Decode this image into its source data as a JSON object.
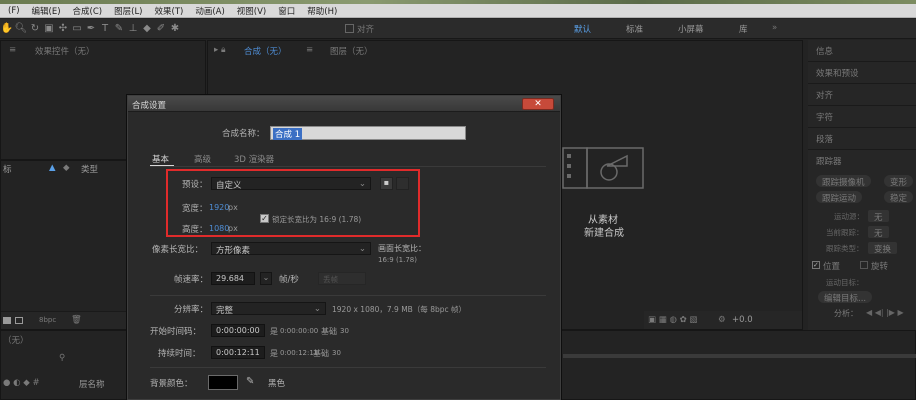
{
  "menu": [
    "(F)",
    "编辑(E)",
    "合成(C)",
    "图层(L)",
    "效果(T)",
    "动画(A)",
    "视图(V)",
    "窗口",
    "帮助(H)"
  ],
  "toolbar": {
    "align_label": "对齐",
    "workspaces": {
      "default": "默认",
      "standard": "标准",
      "small_screen": "小屏幕",
      "library": "库"
    }
  },
  "panels": {
    "effects_tab": "效果控件（无）",
    "comp_tab": "合成（无）",
    "layer_tab": "图层（无）",
    "project_sort_label": "标",
    "project_type_label": "类型",
    "bpc": "8bpc",
    "timeline_none": "（无）",
    "layer_name_label": "层名称",
    "empty_new_comp_line1": "从素材",
    "empty_new_comp_line2": "新建合成",
    "zoom_value": "+0.0"
  },
  "right_panel": {
    "items": [
      "信息",
      "效果和预设",
      "对齐",
      "字符",
      "段落",
      "跟踪器"
    ],
    "tracker": {
      "track_camera": "跟踪摄像机",
      "warp_stabilizer": "变形",
      "track_motion": "跟踪运动",
      "stabilize_motion": "稳定",
      "motion_source_label": "运动源：",
      "current_track_label": "当前跟踪：",
      "track_type_label": "跟踪类型：",
      "motion_source_value": "无",
      "current_track_value": "无",
      "track_type_value": "变换",
      "position_label": "位置",
      "rotation_label": "旋转",
      "motion_target_label": "运动目标：",
      "edit_target_button": "编辑目标...",
      "analyze_label": "分析："
    }
  },
  "dialog": {
    "title": "合成设置",
    "close_glyph": "✕",
    "name_label": "合成名称：",
    "name_value": "合成 1",
    "tabs": [
      "基本",
      "高级",
      "3D 渲染器"
    ],
    "preset_label": "预设：",
    "preset_value": "自定义",
    "width_label": "宽度：",
    "width_value": "1920",
    "height_label": "高度：",
    "height_value": "1080",
    "px_unit": "px",
    "lock_aspect_label": "锁定长宽比为 16:9 (1.78)",
    "lock_aspect_checked": true,
    "par_label": "像素长宽比：",
    "par_value": "方形像素",
    "frame_aspect_label": "画面长宽比：",
    "frame_aspect_value": "16:9 (1.78)",
    "fps_label": "帧速率：",
    "fps_value": "29.684",
    "fps_unit": "帧/秒",
    "fps_drop": "丢帧",
    "res_label": "分辨率：",
    "res_value": "完整",
    "res_info": "1920 x 1080，7.9 MB（每 8bpc 帧）",
    "start_label": "开始时间码：",
    "start_value": "0:00:00:00",
    "start_info_prefix": "是",
    "start_info": "0:00:00:00",
    "base_label": "基础",
    "base_value": "30",
    "duration_label": "持续时间：",
    "duration_value": "0:00:12:11",
    "duration_info_prefix": "是",
    "duration_info": "0:00:12:11",
    "bg_label": "背景颜色：",
    "bg_color": "#000000",
    "bg_color_name": "黑色"
  },
  "colors": {
    "accent_blue": "#4f8ed6",
    "highlight_red": "#e02b2b",
    "close_red": "#c74a3a"
  }
}
